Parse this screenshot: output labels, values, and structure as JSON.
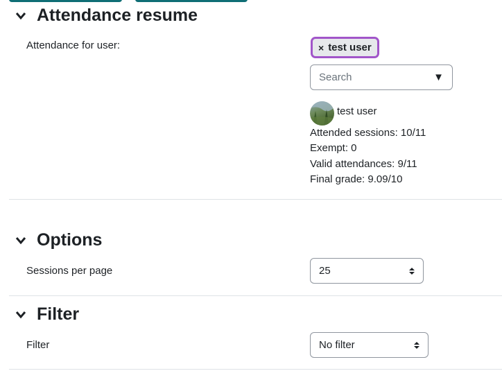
{
  "sections": {
    "attendance_resume": {
      "title": "Attendance resume"
    },
    "options": {
      "title": "Options"
    },
    "filter": {
      "title": "Filter"
    }
  },
  "attendance_for_user": {
    "label": "Attendance for user:",
    "selected_chip": "test user",
    "chip_remove": "×",
    "search_placeholder": "Search",
    "dropdown_arrow": "▼"
  },
  "user_summary": {
    "name": "test user",
    "attended": "Attended sessions: 10/11",
    "exempt": "Exempt: 0",
    "valid": "Valid attendances: 9/11",
    "final_grade": "Final grade: 9.09/10"
  },
  "options": {
    "sessions_per_page_label": "Sessions per page",
    "sessions_per_page_value": "25"
  },
  "filter": {
    "label": "Filter",
    "value": "No filter"
  },
  "colors": {
    "accent_chip_border": "#a155c9",
    "top_button": "#0f6e75"
  },
  "icons": {
    "collapse": "chevron-down-icon",
    "avatar": "user-avatar"
  }
}
